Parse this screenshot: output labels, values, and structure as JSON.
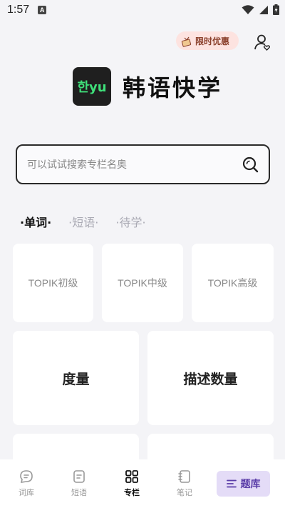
{
  "status_bar": {
    "time": "1:57",
    "notification_icon": "A"
  },
  "header": {
    "promo_label": "限时优惠"
  },
  "brand": {
    "logo_text": "한yu",
    "title": "韩语快学"
  },
  "search": {
    "placeholder": "可以试试搜索专栏名奥"
  },
  "tabs": [
    {
      "label": "·单词·",
      "active": true
    },
    {
      "label": "·短语·",
      "active": false
    },
    {
      "label": "·待学·",
      "active": false
    }
  ],
  "cards_row1": [
    "TOPIK初级",
    "TOPIK中级",
    "TOPIK高级"
  ],
  "cards_row2": [
    "度量",
    "描述数量"
  ],
  "bottom_nav": {
    "items": [
      {
        "label": "词库",
        "icon": "chat-bubble-icon"
      },
      {
        "label": "短语",
        "icon": "document-icon"
      },
      {
        "label": "专栏",
        "icon": "grid-icon",
        "active": true
      },
      {
        "label": "笔记",
        "icon": "notebook-icon"
      }
    ],
    "quiz_label": "题库"
  },
  "colors": {
    "background": "#f4f4f7",
    "accent": "#5a3da8",
    "quiz_bg": "#e4dcf7",
    "promo_bg": "#fde3e0",
    "logo_green": "#3fe07a"
  }
}
